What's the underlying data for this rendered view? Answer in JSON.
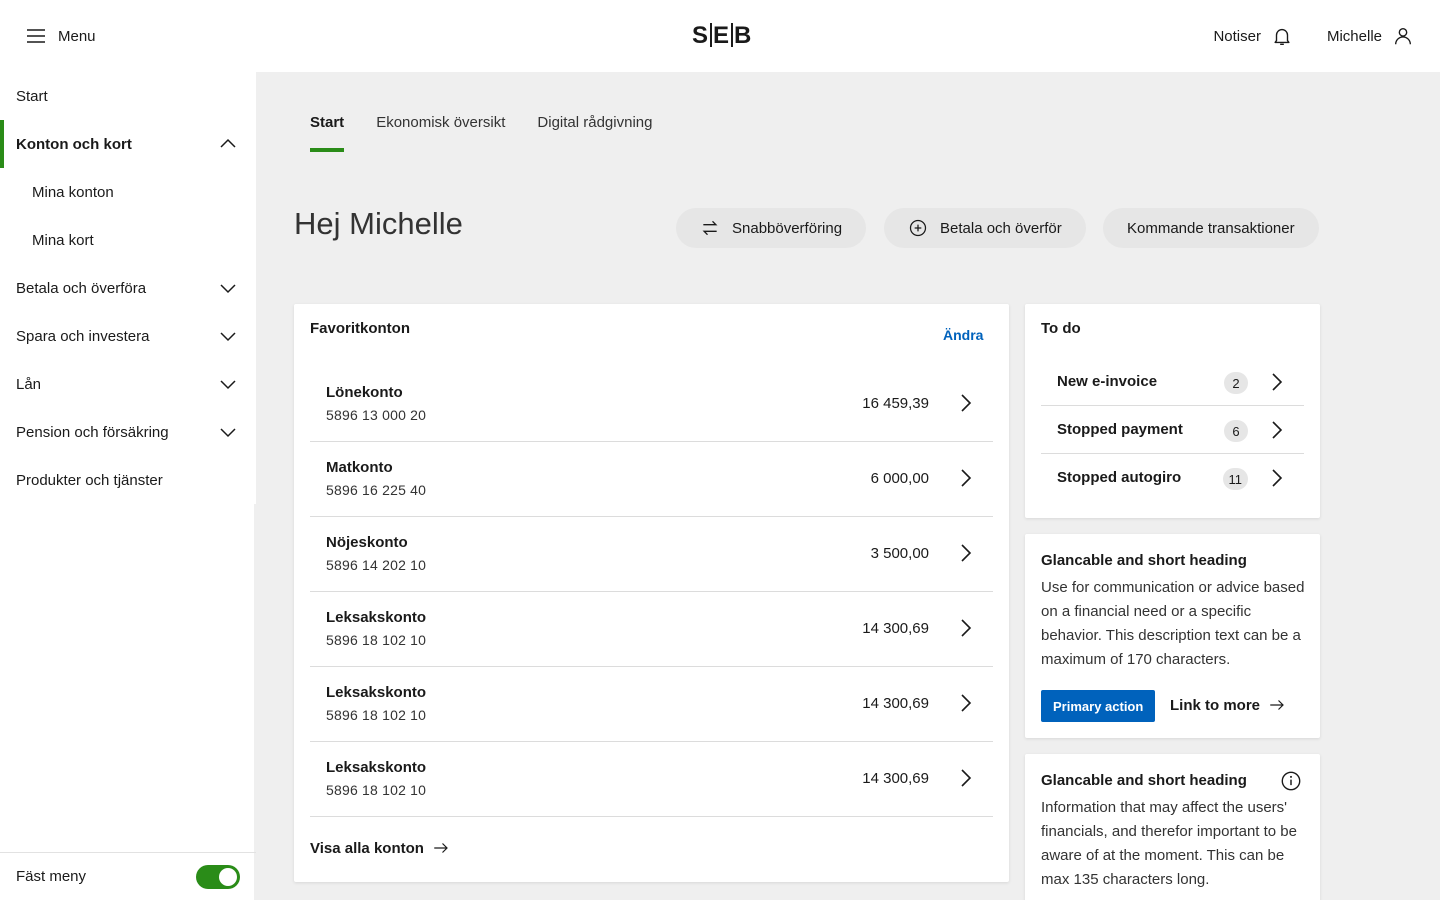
{
  "header": {
    "menu_label": "Menu",
    "logo_left": "S",
    "logo_mid": "E",
    "logo_right": "B",
    "notifications_label": "Notiser",
    "user_label": "Michelle"
  },
  "sidebar": {
    "items": [
      {
        "label": "Start"
      },
      {
        "label": "Konton och kort"
      },
      {
        "label": "Mina konton"
      },
      {
        "label": "Mina kort"
      },
      {
        "label": "Betala och överföra"
      },
      {
        "label": "Spara och investera"
      },
      {
        "label": "Lån"
      },
      {
        "label": "Pension och försäkring"
      },
      {
        "label": "Produkter och tjänster"
      }
    ],
    "pin_menu_label": "Fäst meny",
    "pin_menu_on": true
  },
  "tabs": [
    {
      "label": "Start"
    },
    {
      "label": "Ekonomisk översikt"
    },
    {
      "label": "Digital rådgivning"
    }
  ],
  "greeting": "Hej Michelle",
  "actions": {
    "quick_transfer": "Snabböverföring",
    "pay_transfer": "Betala och överför",
    "upcoming": "Kommande transaktioner"
  },
  "favorites": {
    "title": "Favoritkonton",
    "edit_label": "Ändra",
    "accounts": [
      {
        "name": "Lönekonto",
        "number": "5896 13 000 20",
        "balance": "16 459,39"
      },
      {
        "name": "Matkonto",
        "number": "5896 16 225 40",
        "balance": "6 000,00"
      },
      {
        "name": "Nöjeskonto",
        "number": "5896 14 202 10",
        "balance": "3 500,00"
      },
      {
        "name": "Leksakskonto",
        "number": "5896 18 102 10",
        "balance": "14 300,69"
      },
      {
        "name": "Leksakskonto",
        "number": "5896 18 102 10",
        "balance": "14 300,69"
      },
      {
        "name": "Leksakskonto",
        "number": "5896 18 102 10",
        "balance": "14 300,69"
      }
    ],
    "show_all_label": "Visa alla konton"
  },
  "todo": {
    "title": "To do",
    "items": [
      {
        "label": "New e-invoice",
        "count": "2"
      },
      {
        "label": "Stopped payment",
        "count": "6"
      },
      {
        "label": "Stopped autogiro",
        "count": "11"
      }
    ]
  },
  "advice_card": {
    "heading": "Glancable and short heading",
    "text": "Use for communication or advice based on a financial need or a specific behavior. This description text can be a maximum of 170 characters.",
    "primary_label": "Primary action",
    "link_label": "Link to more"
  },
  "info_card": {
    "heading": "Glancable and short heading",
    "text": "Information that may affect the users' financials, and therefor important to be aware of at the moment. This can be max 135 characters long."
  },
  "colors": {
    "accent_green": "#2a8c18",
    "primary_blue": "#0062bc",
    "background": "#efefef"
  }
}
